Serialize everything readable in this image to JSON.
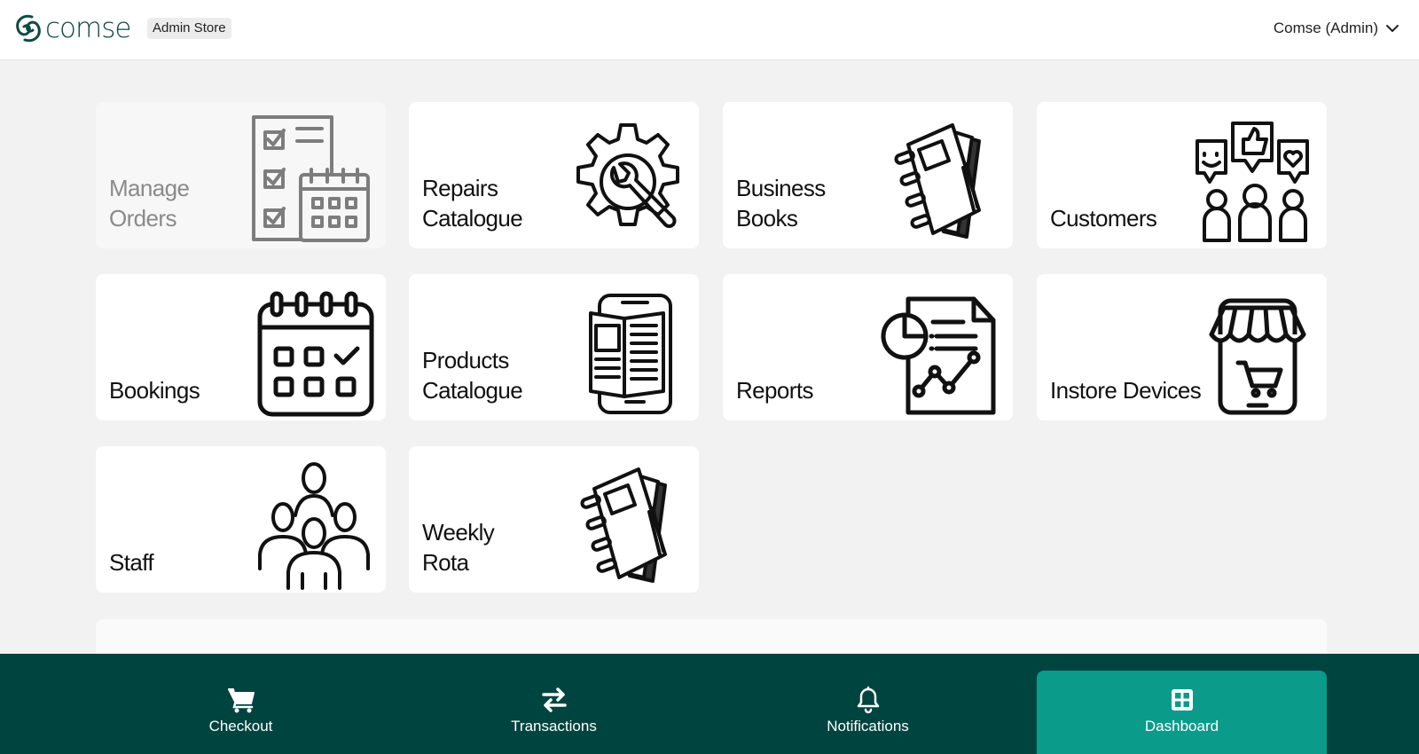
{
  "header": {
    "brand": "comse",
    "store_badge": "Admin Store",
    "user_menu": "Comse (Admin)"
  },
  "tiles": [
    {
      "line1": "Manage",
      "line2": "Orders",
      "icon": "checklist-calendar-icon",
      "disabled": true
    },
    {
      "line1": "Repairs",
      "line2": "Catalogue",
      "icon": "gear-wrench-icon"
    },
    {
      "line1": "Business",
      "line2": "Books",
      "icon": "notebook-icon"
    },
    {
      "line1": "",
      "line2": "Customers",
      "icon": "customers-feedback-icon"
    },
    {
      "line1": "",
      "line2": "Bookings",
      "icon": "calendar-icon"
    },
    {
      "line1": "Products",
      "line2": "Catalogue",
      "icon": "phone-catalogue-icon"
    },
    {
      "line1": "",
      "line2": "Reports",
      "icon": "report-document-icon"
    },
    {
      "line1": "",
      "line2": "Instore Devices",
      "icon": "phone-store-icon"
    },
    {
      "line1": "",
      "line2": "Staff",
      "icon": "staff-group-icon"
    },
    {
      "line1": "Weekly",
      "line2": "Rota",
      "icon": "notebook-icon"
    }
  ],
  "bottom_nav": [
    {
      "label": "Checkout",
      "icon": "cart-icon"
    },
    {
      "label": "Transactions",
      "icon": "arrows-exchange-icon"
    },
    {
      "label": "Notifications",
      "icon": "bell-icon"
    },
    {
      "label": "Dashboard",
      "icon": "grid-icon",
      "active": true
    }
  ],
  "colors": {
    "brand": "#0d4a43",
    "nav_background": "#004440",
    "nav_active": "#0b9b8a",
    "page_background": "#f2f2f2"
  }
}
